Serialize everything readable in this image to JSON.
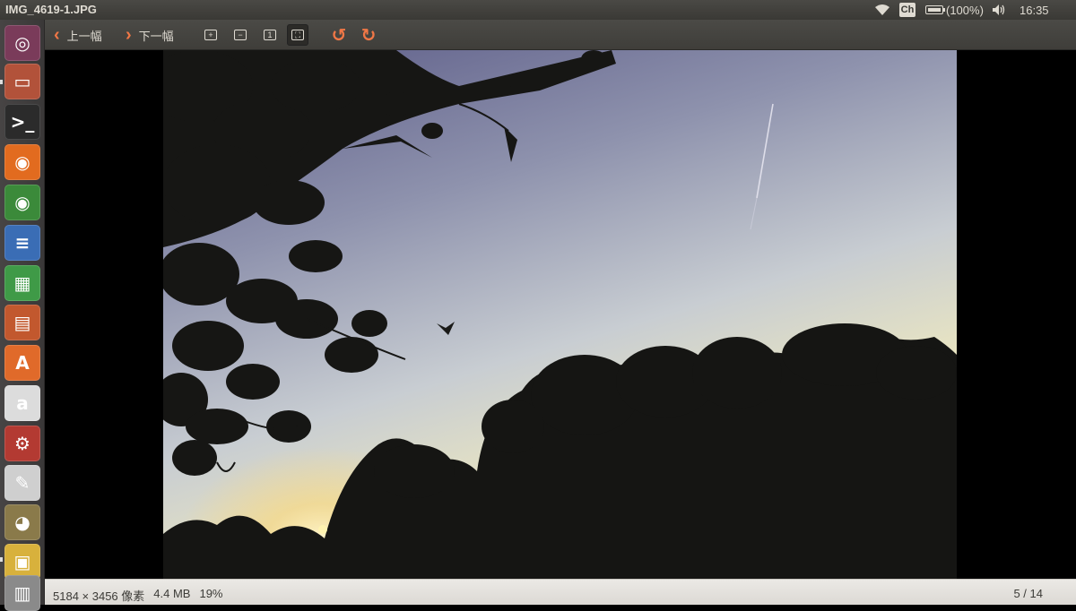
{
  "window": {
    "title": "IMG_4619-1.JPG"
  },
  "panel": {
    "ime": "Ch",
    "battery": "(100%)",
    "clock": "16:35"
  },
  "toolbar": {
    "prev_label": "上一幅",
    "next_label": "下一幅",
    "icons": [
      "zoom-in-icon",
      "zoom-out-icon",
      "normal-size-icon",
      "best-fit-icon",
      "rotate-left-icon",
      "rotate-right-icon"
    ]
  },
  "launcher": {
    "items": [
      {
        "name": "dash",
        "color": "#7a3b5a",
        "glyph": "◎"
      },
      {
        "name": "files",
        "color": "#b2523a",
        "glyph": "▭"
      },
      {
        "name": "terminal",
        "color": "#2b2b2b",
        "glyph": ">_"
      },
      {
        "name": "firefox",
        "color": "#e26b1f",
        "glyph": "◉"
      },
      {
        "name": "chrome",
        "color": "#3b8a3a",
        "glyph": "◉"
      },
      {
        "name": "writer",
        "color": "#3a6db5",
        "glyph": "≡"
      },
      {
        "name": "calc",
        "color": "#3f9a47",
        "glyph": "▦"
      },
      {
        "name": "impress",
        "color": "#c2582e",
        "glyph": "▤"
      },
      {
        "name": "software-center",
        "color": "#e06a2a",
        "glyph": "A"
      },
      {
        "name": "amazon",
        "color": "#dcdcdc",
        "glyph": "a"
      },
      {
        "name": "system-settings",
        "color": "#b33a32",
        "glyph": "⚙"
      },
      {
        "name": "text-editor",
        "color": "#cfcfcf",
        "glyph": "✎"
      },
      {
        "name": "gimp",
        "color": "#8a7a4a",
        "glyph": "◕"
      },
      {
        "name": "image-viewer",
        "color": "#d8b13c",
        "glyph": "▣"
      },
      {
        "name": "workspaces",
        "color": "#8a8a8a",
        "glyph": "▥"
      }
    ]
  },
  "statusbar": {
    "dimensions": "5184 × 3456 像素",
    "filesize": "4.4 MB",
    "zoom": "19%",
    "page": "5 / 14"
  },
  "colors": {
    "accent": "#f07746",
    "panel": "#3c3b37",
    "status": "#e4e2de"
  }
}
